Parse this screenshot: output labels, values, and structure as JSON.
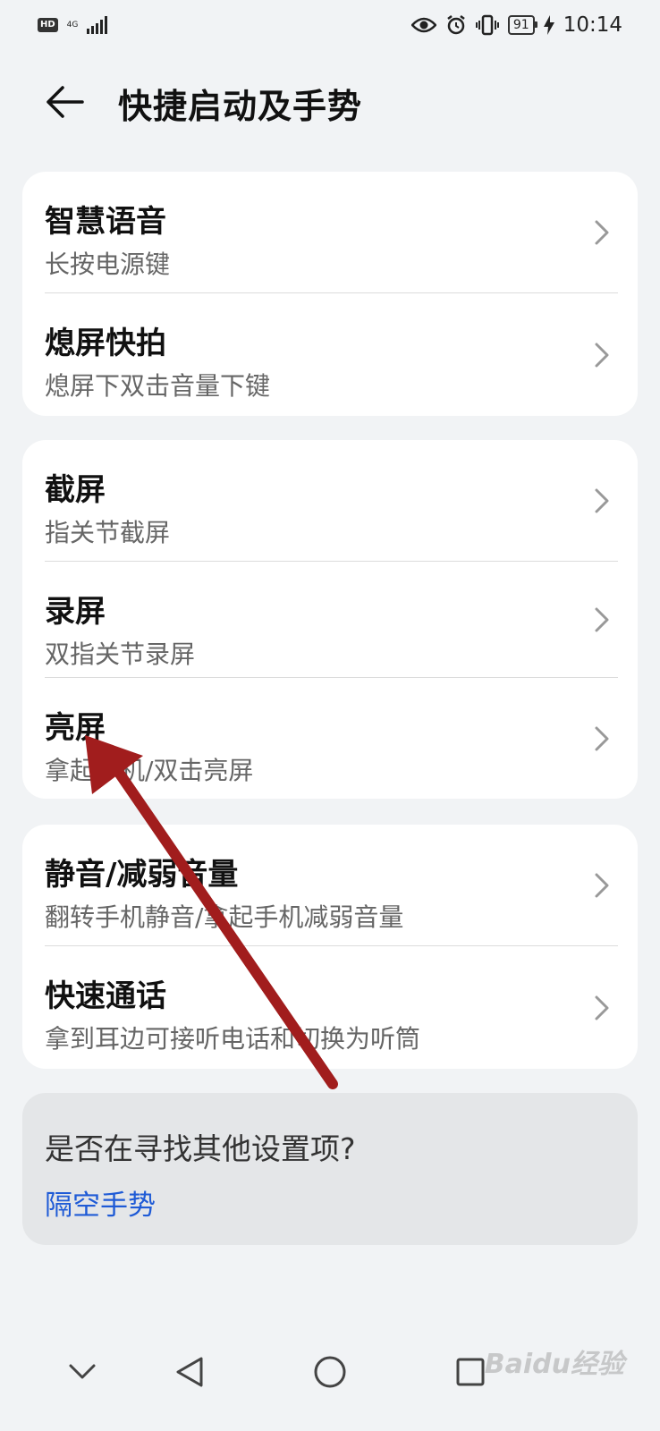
{
  "status_bar": {
    "hd": "HD",
    "network": "4G",
    "battery": "91",
    "time": "10:14"
  },
  "header": {
    "title": "快捷启动及手势"
  },
  "cards": [
    {
      "items": [
        {
          "title": "智慧语音",
          "subtitle": "长按电源键"
        },
        {
          "title": "熄屏快拍",
          "subtitle": "熄屏下双击音量下键"
        }
      ]
    },
    {
      "items": [
        {
          "title": "截屏",
          "subtitle": "指关节截屏"
        },
        {
          "title": "录屏",
          "subtitle": "双指关节录屏"
        },
        {
          "title": "亮屏",
          "subtitle": "拿起手机/双击亮屏"
        }
      ]
    },
    {
      "items": [
        {
          "title": "静音/减弱音量",
          "subtitle": "翻转手机静音/拿起手机减弱音量"
        },
        {
          "title": "快速通话",
          "subtitle": "拿到耳边可接听电话和切换为听筒"
        }
      ]
    }
  ],
  "suggestion": {
    "title": "是否在寻找其他设置项?",
    "link": "隔空手势"
  },
  "watermark": "Baidu经验",
  "colors": {
    "background": "#f1f3f5",
    "link": "#1f5bd6",
    "annotation_arrow": "#a11d1d"
  }
}
